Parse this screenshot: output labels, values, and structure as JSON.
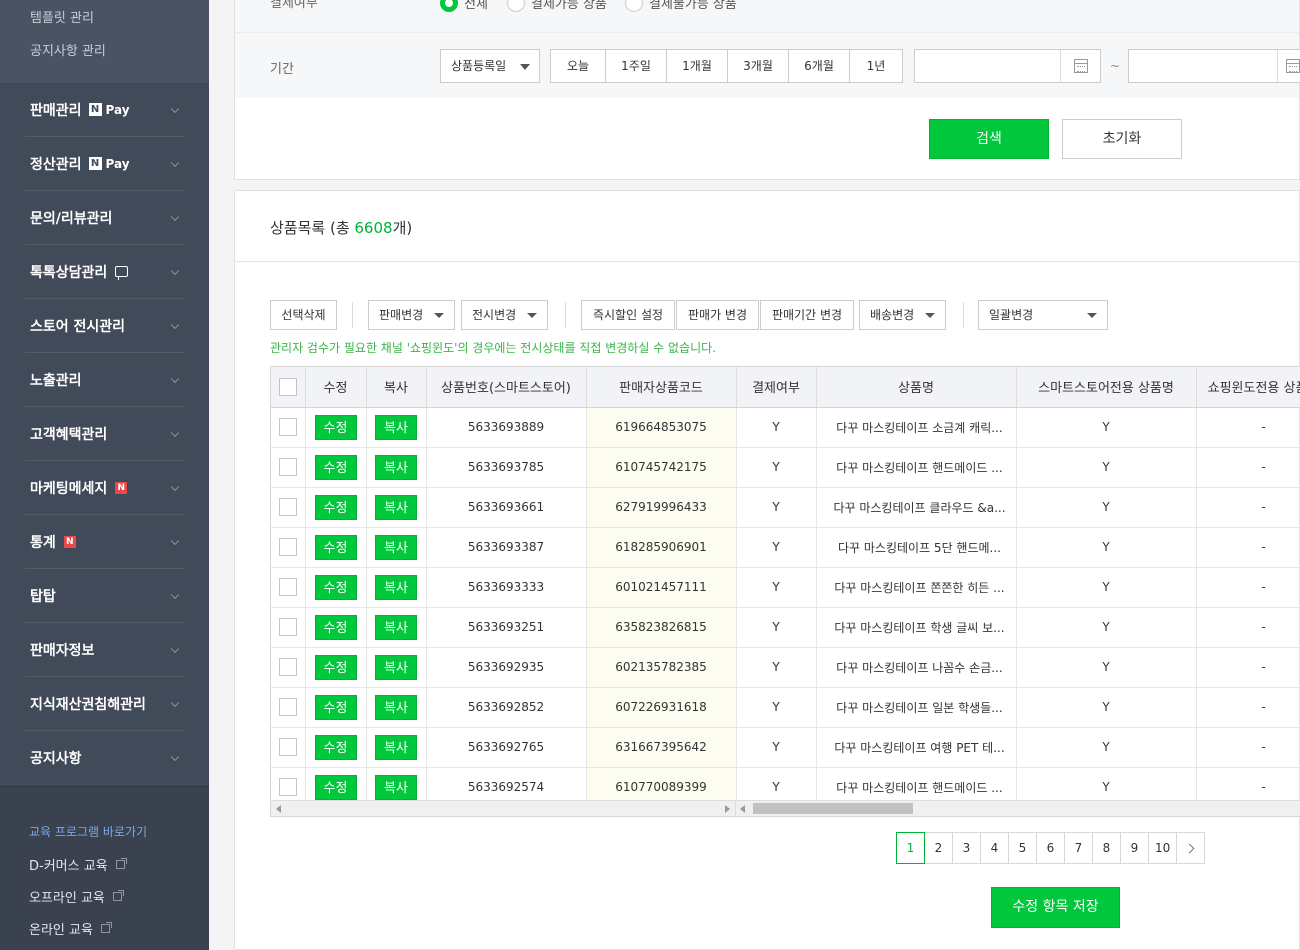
{
  "sidebar": {
    "sub_items": [
      "템플릿 관리",
      "공지사항 관리"
    ],
    "menu": [
      {
        "label": "판매관리",
        "badge": "npay"
      },
      {
        "label": "정산관리",
        "badge": "npay"
      },
      {
        "label": "문의/리뷰관리",
        "badge": ""
      },
      {
        "label": "톡톡상담관리",
        "badge": "talk"
      },
      {
        "label": "스토어 전시관리",
        "badge": ""
      },
      {
        "label": "노출관리",
        "badge": ""
      },
      {
        "label": "고객혜택관리",
        "badge": ""
      },
      {
        "label": "마케팅메세지",
        "badge": "n"
      },
      {
        "label": "통계",
        "badge": "n"
      },
      {
        "label": "탑탑",
        "badge": ""
      },
      {
        "label": "판매자정보",
        "badge": ""
      },
      {
        "label": "지식재산권침해관리",
        "badge": ""
      },
      {
        "label": "공지사항",
        "badge": ""
      }
    ],
    "npay_text": "Pay",
    "npay_n": "N",
    "n_badge": "N",
    "edu": {
      "title": "교육 프로그램 바로가기",
      "links": [
        "D-커머스 교육",
        "오프라인 교육",
        "온라인 교육"
      ]
    }
  },
  "search": {
    "pay_label": "결제여부",
    "pay_options": [
      "전체",
      "결제가능 상품",
      "결제불가능 상품"
    ],
    "period_label": "기간",
    "period_select": "상품등록일",
    "period_buttons": [
      "오늘",
      "1주일",
      "1개월",
      "3개월",
      "6개월",
      "1년"
    ],
    "tilde": "~",
    "search_btn": "검색",
    "reset_btn": "초기화"
  },
  "list": {
    "title": "상품목록 (총 ",
    "count": "6608",
    "title_suffix": "개)",
    "toolbar": {
      "delete": "선택삭제",
      "sale_change": "판매변경",
      "display_change": "전시변경",
      "instant_discount": "즉시할인 설정",
      "price_change": "판매가 변경",
      "period_change": "판매기간 변경",
      "delivery_change": "배송변경",
      "bulk_change": "일괄변경"
    },
    "notice": "관리자 검수가 필요한 채널 '쇼핑윈도'의 경우에는 전시상태를 직접 변경하실 수 없습니다.",
    "columns": [
      "",
      "수정",
      "복사",
      "상품번호(스마트스토어)",
      "판매자상품코드",
      "결제여부",
      "상품명",
      "스마트스토어전용 상품명",
      "쇼핑윈도전용 상품명"
    ],
    "edit_label": "수정",
    "copy_label": "복사",
    "rows": [
      {
        "id": "5633693889",
        "code": "619664853075",
        "pay": "Y",
        "name": "다꾸 마스킹테이프 소금계 캐릭...",
        "ss": "Y",
        "sw": "-"
      },
      {
        "id": "5633693785",
        "code": "610745742175",
        "pay": "Y",
        "name": "다꾸 마스킹테이프 핸드메이드 ...",
        "ss": "Y",
        "sw": "-"
      },
      {
        "id": "5633693661",
        "code": "627919996433",
        "pay": "Y",
        "name": "다꾸 마스킹테이프 클라우드 &a...",
        "ss": "Y",
        "sw": "-"
      },
      {
        "id": "5633693387",
        "code": "618285906901",
        "pay": "Y",
        "name": "다꾸 마스킹테이프 5단 핸드메...",
        "ss": "Y",
        "sw": "-"
      },
      {
        "id": "5633693333",
        "code": "601021457111",
        "pay": "Y",
        "name": "다꾸 마스킹테이프 쫀쫀한 히든 ...",
        "ss": "Y",
        "sw": "-"
      },
      {
        "id": "5633693251",
        "code": "635823826815",
        "pay": "Y",
        "name": "다꾸 마스킹테이프 학생 글씨 보...",
        "ss": "Y",
        "sw": "-"
      },
      {
        "id": "5633692935",
        "code": "602135782385",
        "pay": "Y",
        "name": "다꾸 마스킹테이프 나꼼수 손금...",
        "ss": "Y",
        "sw": "-"
      },
      {
        "id": "5633692852",
        "code": "607226931618",
        "pay": "Y",
        "name": "다꾸 마스킹테이프 일본 학생들...",
        "ss": "Y",
        "sw": "-"
      },
      {
        "id": "5633692765",
        "code": "631667395642",
        "pay": "Y",
        "name": "다꾸 마스킹테이프 여행 PET 테...",
        "ss": "Y",
        "sw": "-"
      },
      {
        "id": "5633692574",
        "code": "610770089399",
        "pay": "Y",
        "name": "다꾸 마스킹테이프 핸드메이드 ...",
        "ss": "Y",
        "sw": "-"
      }
    ],
    "pages": [
      "1",
      "2",
      "3",
      "4",
      "5",
      "6",
      "7",
      "8",
      "9",
      "10"
    ],
    "save_btn": "수정 항목 저장"
  },
  "colors": {
    "accent": "#00c73c",
    "sidebar": "#414a59",
    "link": "#1a6fd2"
  }
}
